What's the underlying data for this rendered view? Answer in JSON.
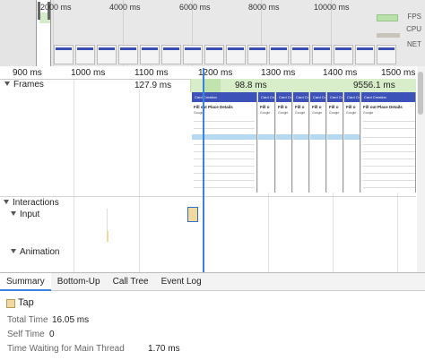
{
  "overview": {
    "ticks": [
      "2000 ms",
      "4000 ms",
      "6000 ms",
      "8000 ms",
      "10000 ms"
    ],
    "labels": {
      "fps": "FPS",
      "cpu": "CPU",
      "net": "NET"
    }
  },
  "ruler": {
    "ticks": [
      "900 ms",
      "1000 ms",
      "1100 ms",
      "1200 ms",
      "1300 ms",
      "1400 ms",
      "1500 ms"
    ]
  },
  "frames": {
    "label": "Frames",
    "durations": [
      "127.9 ms",
      "98.8 ms",
      "9556.1 ms"
    ]
  },
  "filmstrip": {
    "header": "Card Creation",
    "subtitle": "Fill out Place Details",
    "subtitle_short": "Fill o",
    "subtext": "Google"
  },
  "interactions": {
    "label": "Interactions",
    "input_label": "Input",
    "animation_label": "Animation"
  },
  "tabs": [
    "Summary",
    "Bottom-Up",
    "Call Tree",
    "Event Log"
  ],
  "summary": {
    "title": "Tap",
    "rows": [
      {
        "label": "Total Time",
        "value": "16.05 ms"
      },
      {
        "label": "Self Time",
        "value": "0"
      },
      {
        "label": "Time Waiting for Main Thread",
        "value": "1.70 ms"
      }
    ]
  },
  "colors": {
    "accent": "#3b82e0",
    "frame_green": "#d8eecb",
    "input_event": "#f0d9a0",
    "card_header": "#3c52b8"
  }
}
